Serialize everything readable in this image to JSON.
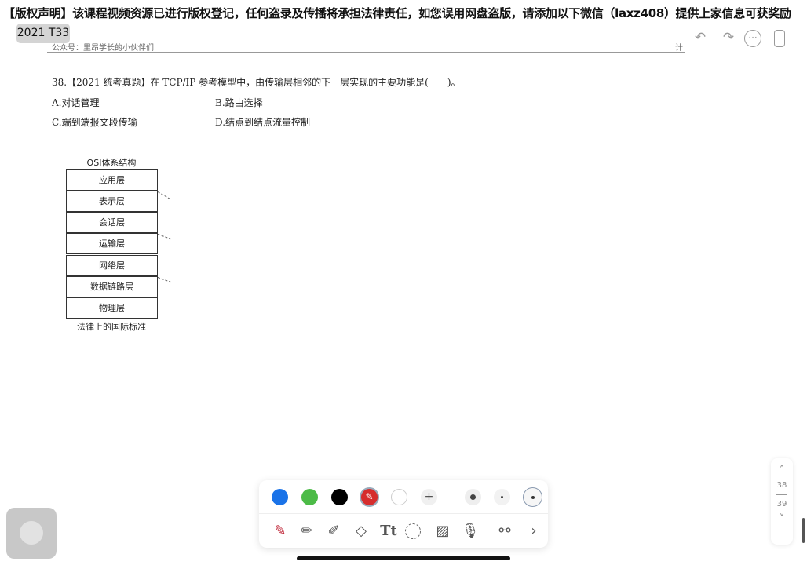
{
  "notice": "【版权声明】该课程视频资源已进行版权登记，任何盗录及传播将承担法律责任，如您误用网盘盗版，请添加以下微信（laxz408）提供上家信息可获奖励",
  "badge": "2021 T33",
  "doc": {
    "footer": "公众号：里昂学长的小伙伴们",
    "footer_right": "计"
  },
  "question": {
    "stem": "38.【2021 统考真题】在 TCP/IP 参考模型中，由传输层相邻的下一层实现的主要功能是(　　)。",
    "options": [
      "A.对话管理",
      "B.路由选择",
      "C.端到端报文段传输",
      "D.结点到结点流量控制"
    ]
  },
  "osi": {
    "title": "OSI体系结构",
    "layers": [
      "应用层",
      "表示层",
      "会话层",
      "运输层",
      "网络层",
      "数据链路层",
      "物理层"
    ],
    "footer": "法律上的国际标准"
  },
  "toolbar": {
    "colors": [
      "#1a73e8",
      "#4cbb47",
      "#000000",
      "#d62d2d",
      "#ffffff"
    ],
    "add": "+",
    "tools": [
      "pen",
      "pencil",
      "highlighter",
      "eraser",
      "text",
      "lasso",
      "image",
      "microphone",
      "link",
      "more"
    ]
  },
  "pager": {
    "current": "38",
    "total": "39"
  }
}
